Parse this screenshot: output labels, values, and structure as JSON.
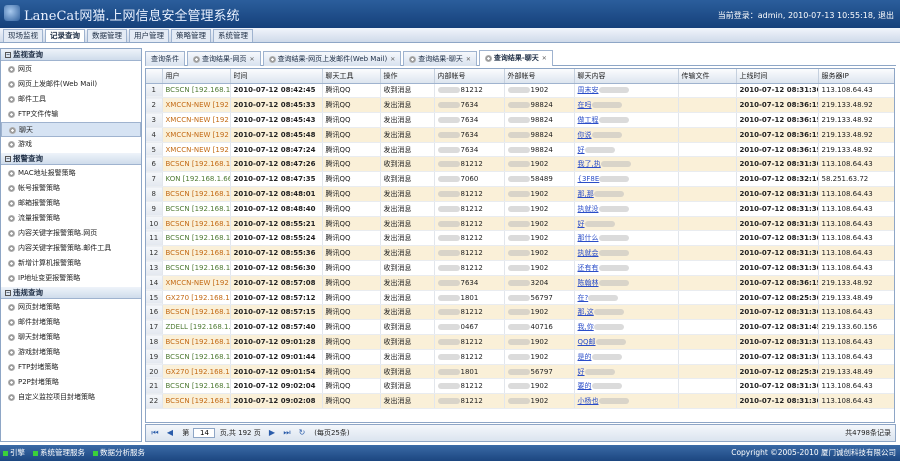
{
  "app": {
    "title": "LaneCat网猫.上网信息安全管理系统",
    "login_label": "当前登录：",
    "user": "admin",
    "datetime": "2010-07-13 10:55:18",
    "logout": "退出"
  },
  "main_nav": [
    "现场监视",
    "记录查询",
    "数据管理",
    "用户管理",
    "策略管理",
    "系统管理"
  ],
  "active_nav": 1,
  "sidebar": {
    "sections": [
      {
        "title": "监视查询",
        "items": [
          "网页",
          "网页上发邮件(Web Mail)",
          "邮件工具",
          "FTP文件传输",
          "聊天",
          "游戏"
        ]
      },
      {
        "title": "报警查询",
        "items": [
          "MAC地址报警策略",
          "帐号报警策略",
          "邮箱报警策略",
          "流量报警策略",
          "内容关键字报警策略.网页",
          "内容关键字报警策略.邮件工具",
          "新增计算机报警策略",
          "IP地址变更报警策略"
        ]
      },
      {
        "title": "违规查询",
        "items": [
          "网页封堵策略",
          "邮件封堵策略",
          "聊天封堵策略",
          "游戏封堵策略",
          "FTP封堵策略",
          "P2P封堵策略",
          "自定义监控项目封堵策略"
        ]
      }
    ],
    "active_item": "聊天"
  },
  "tabs": [
    "查询条件",
    "查询结果-网页",
    "查询结果-网页上发邮件(Web Mail)",
    "查询结果-聊天",
    "查询结果-聊天"
  ],
  "active_tab": 4,
  "table": {
    "headers": [
      "",
      "用户",
      "时间",
      "聊天工具",
      "操作",
      "内部帐号",
      "外部帐号",
      "聊天内容",
      "传输文件",
      "上线时间",
      "服务器IP"
    ],
    "rows": [
      [
        "1",
        "BCSCN [192.168.1",
        "2010-07-12 08:42:45",
        "腾讯QQ",
        "收到消息",
        "81212",
        "1902",
        "周末安",
        "",
        " 2010-07-12 08:31:30",
        "113.108.64.43"
      ],
      [
        "2",
        "XMCCN-NEW [192",
        "2010-07-12 08:45:33",
        "腾讯QQ",
        "发出消息",
        "7634",
        "98824",
        "在吗",
        "",
        " 2010-07-12 08:36:15",
        "219.133.48.92"
      ],
      [
        "3",
        "XMCCN-NEW [192",
        "2010-07-12 08:45:43",
        "腾讯QQ",
        "发出消息",
        "7634",
        "98824",
        "做工程",
        "",
        " 2010-07-12 08:36:15",
        "219.133.48.92"
      ],
      [
        "4",
        "XMCCN-NEW [192",
        "2010-07-12 08:45:48",
        "腾讯QQ",
        "发出消息",
        "7634",
        "98824",
        "你说",
        "",
        " 2010-07-12 08:36:15",
        "219.133.48.92"
      ],
      [
        "5",
        "XMCCN-NEW [192",
        "2010-07-12 08:47:24",
        "腾讯QQ",
        "发出消息",
        "7634",
        "98824",
        "好",
        "",
        " 2010-07-12 08:36:15",
        "219.133.48.92"
      ],
      [
        "6",
        "BCSCN [192.168.1",
        "2010-07-12 08:47:26",
        "腾讯QQ",
        "收到消息",
        "81212",
        "1902",
        "我了,执",
        "",
        "2010-07-12 08:31:30",
        "113.108.64.43"
      ],
      [
        "7",
        "KON [192.168.1.66",
        "2010-07-12 08:47:35",
        "腾讯QQ",
        "收到消息",
        "7060",
        "58489",
        "{3F8E",
        "",
        "2010-07-12 08:32:16",
        "58.251.63.72"
      ],
      [
        "8",
        "BCSCN [192.168.1",
        "2010-07-12 08:48:01",
        "腾讯QQ",
        "发出消息",
        "81212",
        "1902",
        "那,那",
        "",
        "2010-07-12 08:31:30",
        "113.108.64.43"
      ],
      [
        "9",
        "BCSCN [192.168.1",
        "2010-07-12 08:48:40",
        "腾讯QQ",
        "发出消息",
        "81212",
        "1902",
        "执就没",
        "",
        "2010-07-12 08:31:30",
        "113.108.64.43"
      ],
      [
        "10",
        "BCSCN [192.168.1",
        "2010-07-12 08:55:21",
        "腾讯QQ",
        "发出消息",
        "81212",
        "1902",
        "好",
        "",
        "2010-07-12 08:31:30",
        "113.108.64.43"
      ],
      [
        "11",
        "BCSCN [192.168.1",
        "2010-07-12 08:55:24",
        "腾讯QQ",
        "发出消息",
        "81212",
        "1902",
        "那什么",
        "",
        "2010-07-12 08:31:30",
        "113.108.64.43"
      ],
      [
        "12",
        "BCSCN [192.168.1",
        "2010-07-12 08:55:36",
        "腾讯QQ",
        "发出消息",
        "81212",
        "1902",
        "执就会",
        "",
        "2010-07-12 08:31:30",
        "113.108.64.43"
      ],
      [
        "13",
        "BCSCN [192.168.1",
        "2010-07-12 08:56:30",
        "腾讯QQ",
        "收到消息",
        "81212",
        "1902",
        "还有有",
        "",
        "2010-07-12 08:31:30",
        "113.108.64.43"
      ],
      [
        "14",
        "XMCCN-NEW [192",
        "2010-07-12 08:57:08",
        "腾讯QQ",
        "发出消息",
        "7634",
        "3204",
        "陈翰林",
        "",
        "2010-07-12 08:36:15",
        "219.133.48.92"
      ],
      [
        "15",
        "GX270 [192.168.1.",
        "2010-07-12 08:57:12",
        "腾讯QQ",
        "发出消息",
        "1801",
        "56797",
        "在?",
        "",
        "2010-07-12 08:25:30",
        "219.133.48.49"
      ],
      [
        "16",
        "BCSCN [192.168.1",
        "2010-07-12 08:57:15",
        "腾讯QQ",
        "发出消息",
        "81212",
        "1902",
        "那,这",
        "",
        "2010-07-12 08:31:30",
        "113.108.64.43"
      ],
      [
        "17",
        "ZDELL [192.168.1.",
        "2010-07-12 08:57:40",
        "腾讯QQ",
        "收到消息",
        "0467",
        "40716",
        "我,你",
        "",
        "2010-07-12 08:31:45",
        "219.133.60.156"
      ],
      [
        "18",
        "BCSCN [192.168.1",
        "2010-07-12 09:01:28",
        "腾讯QQ",
        "收到消息",
        "81212",
        "1902",
        "QQ邮",
        "",
        "2010-07-12 08:31:30",
        "113.108.64.43"
      ],
      [
        "19",
        "BCSCN [192.168.1",
        "2010-07-12 09:01:44",
        "腾讯QQ",
        "发出消息",
        "81212",
        "1902",
        "是的",
        "",
        "2010-07-12 08:31:30",
        "113.108.64.43"
      ],
      [
        "20",
        "GX270 [192.168.1.",
        "2010-07-12 09:01:54",
        "腾讯QQ",
        "收到消息",
        "1801",
        "56797",
        "好",
        "",
        "2010-07-12 08:25:30",
        "219.133.48.49"
      ],
      [
        "21",
        "BCSCN [192.168.1",
        "2010-07-12 09:02:04",
        "腾讯QQ",
        "收到消息",
        "81212",
        "1902",
        "要的",
        "",
        "2010-07-12 08:31:30",
        "113.108.64.43"
      ],
      [
        "22",
        "BCSCN [192.168.1",
        "2010-07-12 09:02:08",
        "腾讯QQ",
        "发出消息",
        "81212",
        "1902",
        "小杨也",
        "",
        "2010-07-12 08:31:30",
        "113.108.64.43"
      ]
    ]
  },
  "pager": {
    "page_label": "第",
    "page": "14",
    "total_pages": "页,共 192 页",
    "per_page": "(每页25条)",
    "total": "共4798条记录"
  },
  "status": {
    "items": [
      "引擎",
      "系统管理服务",
      "数据分析服务"
    ],
    "copyright": "Copyright ©2005-2010 厦门诚创科技有限公司"
  }
}
